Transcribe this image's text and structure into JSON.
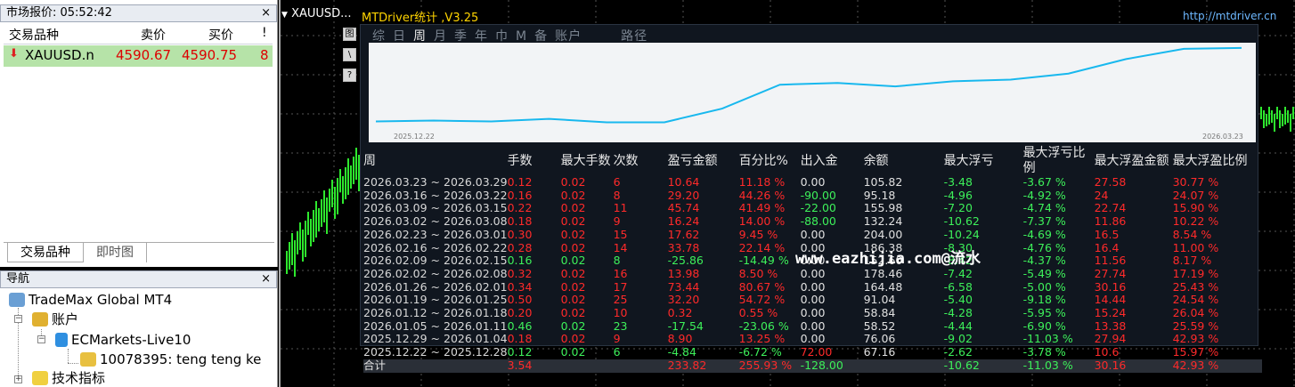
{
  "market_watch": {
    "title": "市场报价: 05:52:42",
    "close": "×",
    "columns": [
      "交易品种",
      "卖价",
      "买价",
      "!"
    ],
    "row": {
      "symbol": "XAUUSD.n",
      "bid": "4590.67",
      "ask": "4590.75",
      "spread": "8"
    },
    "tabs": [
      "交易品种",
      "即时图"
    ]
  },
  "navigator": {
    "title": "导航",
    "close": "×",
    "items": [
      "TradeMax Global MT4",
      "账户",
      "ECMarkets-Live10",
      "10078395: teng teng ke",
      "技术指标"
    ]
  },
  "chart": {
    "symbol": "XAUUSD...",
    "indicator_title": "MTDriver统计 ,V3.25",
    "url": "http://mtdriver.cn",
    "side_buttons": [
      "图",
      "\\",
      "?"
    ],
    "modes": [
      "综",
      "日",
      "周",
      "月",
      "季",
      "年",
      "巾",
      "M",
      "备",
      "账户",
      "路径"
    ],
    "active_mode": "周",
    "curve_start": "2025.12.22",
    "curve_end": "2026.03.23",
    "headers": [
      "周",
      "手数",
      "最大手数",
      "次数",
      "盈亏金额",
      "百分比%",
      "出入金",
      "余额",
      "最大浮亏",
      "最大浮亏比例",
      "最大浮盈金额",
      "最大浮盈比例"
    ],
    "rows": [
      [
        "2026.03.23 ~ 2026.03.29",
        "0.12",
        "0.02",
        "6",
        "10.64",
        "11.18 %",
        "0.00",
        "105.82",
        "-3.48",
        "-3.67 %",
        "27.58",
        "30.77 %"
      ],
      [
        "2026.03.16 ~ 2026.03.22",
        "0.16",
        "0.02",
        "8",
        "29.20",
        "44.26 %",
        "-90.00",
        "95.18",
        "-4.96",
        "-4.92 %",
        "24",
        "24.07 %"
      ],
      [
        "2026.03.09 ~ 2026.03.15",
        "0.22",
        "0.02",
        "11",
        "45.74",
        "41.49 %",
        "-22.00",
        "155.98",
        "-7.20",
        "-4.74 %",
        "22.74",
        "15.90 %"
      ],
      [
        "2026.03.02 ~ 2026.03.08",
        "0.18",
        "0.02",
        "9",
        "16.24",
        "14.00 %",
        "-88.00",
        "132.24",
        "-10.62",
        "-7.37 %",
        "11.86",
        "10.22 %"
      ],
      [
        "2026.02.23 ~ 2026.03.01",
        "0.30",
        "0.02",
        "15",
        "17.62",
        "9.45 %",
        "0.00",
        "204.00",
        "-10.24",
        "-4.69 %",
        "16.5",
        "8.54 %"
      ],
      [
        "2026.02.16 ~ 2026.02.22",
        "0.28",
        "0.02",
        "14",
        "33.78",
        "22.14 %",
        "0.00",
        "186.38",
        "-8.30",
        "-4.76 %",
        "16.4",
        "11.00 %"
      ],
      [
        "2026.02.09 ~ 2026.02.15",
        "0.16",
        "0.02",
        "8",
        "-25.86",
        "-14.49 %",
        "0.00",
        "152.60",
        "-8.42",
        "-4.37 %",
        "11.56",
        "8.17 %"
      ],
      [
        "2026.02.02 ~ 2026.02.08",
        "0.32",
        "0.02",
        "16",
        "13.98",
        "8.50 %",
        "0.00",
        "178.46",
        "-7.42",
        "-5.49 %",
        "27.74",
        "17.19 %"
      ],
      [
        "2026.01.26 ~ 2026.02.01",
        "0.34",
        "0.02",
        "17",
        "73.44",
        "80.67 %",
        "0.00",
        "164.48",
        "-6.58",
        "-5.00 %",
        "30.16",
        "25.43 %"
      ],
      [
        "2026.01.19 ~ 2026.01.25",
        "0.50",
        "0.02",
        "25",
        "32.20",
        "54.72 %",
        "0.00",
        "91.04",
        "-5.40",
        "-9.18 %",
        "14.44",
        "24.54 %"
      ],
      [
        "2026.01.12 ~ 2026.01.18",
        "0.20",
        "0.02",
        "10",
        "0.32",
        "0.55 %",
        "0.00",
        "58.84",
        "-4.28",
        "-5.95 %",
        "15.24",
        "26.04 %"
      ],
      [
        "2026.01.05 ~ 2026.01.11",
        "0.46",
        "0.02",
        "23",
        "-17.54",
        "-23.06 %",
        "0.00",
        "58.52",
        "-4.44",
        "-6.90 %",
        "13.38",
        "25.59 %"
      ],
      [
        "2025.12.29 ~ 2026.01.04",
        "0.18",
        "0.02",
        "9",
        "8.90",
        "13.25 %",
        "0.00",
        "76.06",
        "-9.02",
        "-11.03 %",
        "27.94",
        "42.93 %"
      ],
      [
        "2025.12.22 ~ 2025.12.28",
        "0.12",
        "0.02",
        "6",
        "-4.84",
        "-6.72 %",
        "72.00",
        "67.16",
        "-2.62",
        "-3.78 %",
        "10.6",
        "15.97 %"
      ]
    ],
    "total": [
      "合计",
      "3.54",
      "",
      "",
      "233.82",
      "255.93 %",
      "-128.00",
      "",
      "-10.62",
      "-11.03 %",
      "30.16",
      "42.93 %"
    ],
    "watermark": "www.eazhijia.com@流水",
    "curve": [
      0.12,
      0.13,
      0.12,
      0.15,
      0.11,
      0.11,
      0.27,
      0.55,
      0.57,
      0.53,
      0.59,
      0.61,
      0.68,
      0.85,
      0.97,
      0.98
    ],
    "colors": {
      "positive": "#3df05a",
      "negative": "#ff2a2a",
      "curve": "#18b8ee"
    }
  }
}
